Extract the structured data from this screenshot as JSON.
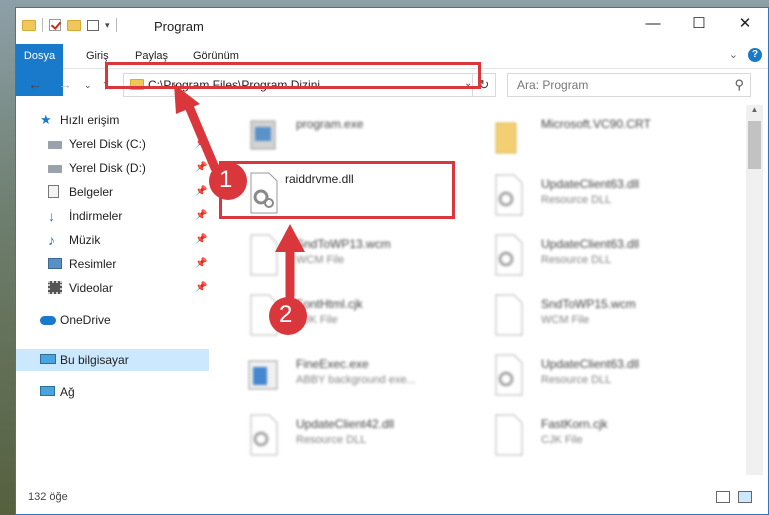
{
  "window": {
    "title": "Program"
  },
  "ribbon": {
    "tabs": [
      "Dosya",
      "Giriş",
      "Paylaş",
      "Görünüm"
    ],
    "expand_icon": "chevron-down-icon",
    "help_icon": "help-icon"
  },
  "nav": {
    "address": "C:\\Program Files\\Program Dizini",
    "search_placeholder": "Ara: Program"
  },
  "sidebar": {
    "items": [
      {
        "label": "Hızlı erişim",
        "icon": "star-icon"
      },
      {
        "label": "Yerel Disk (C:)",
        "icon": "drive-icon"
      },
      {
        "label": "Yerel Disk (D:)",
        "icon": "drive-icon"
      },
      {
        "label": "Belgeler",
        "icon": "document-icon"
      },
      {
        "label": "İndirmeler",
        "icon": "download-icon"
      },
      {
        "label": "Müzik",
        "icon": "music-icon"
      },
      {
        "label": "Resimler",
        "icon": "pictures-icon"
      },
      {
        "label": "Videolar",
        "icon": "video-icon"
      },
      {
        "label": "OneDrive",
        "icon": "cloud-icon"
      },
      {
        "label": "Bu bilgisayar",
        "icon": "computer-icon"
      },
      {
        "label": "Ağ",
        "icon": "network-icon"
      }
    ]
  },
  "files": {
    "left": [
      {
        "name": "program.exe",
        "type": ""
      },
      {
        "name": "raiddrvme.dll",
        "type": ""
      },
      {
        "name": "SndToWP13.wcm",
        "type": "WCM File"
      },
      {
        "name": "FontHtml.cjk",
        "type": "CJK File"
      },
      {
        "name": "FineExec.exe",
        "type": "ABBY background exe..."
      },
      {
        "name": "UpdateClient42.dll",
        "type": "Resource DLL"
      }
    ],
    "right": [
      {
        "name": "Microsoft.VC90.CRT",
        "type": ""
      },
      {
        "name": "UpdateClient63.dll",
        "type": "Resource DLL"
      },
      {
        "name": "UpdateClient63.dll",
        "type": "Resource DLL"
      },
      {
        "name": "SndToWP15.wcm",
        "type": "WCM File"
      },
      {
        "name": "UpdateClient63.dll",
        "type": "Resource DLL"
      },
      {
        "name": "FastKorn.cjk",
        "type": "CJK File"
      }
    ]
  },
  "status": {
    "item_count": "132 öğe"
  },
  "annotations": {
    "step1": "1",
    "step2": "2"
  },
  "colors": {
    "accent": "#1979ca",
    "highlight_red": "#d9373b"
  }
}
